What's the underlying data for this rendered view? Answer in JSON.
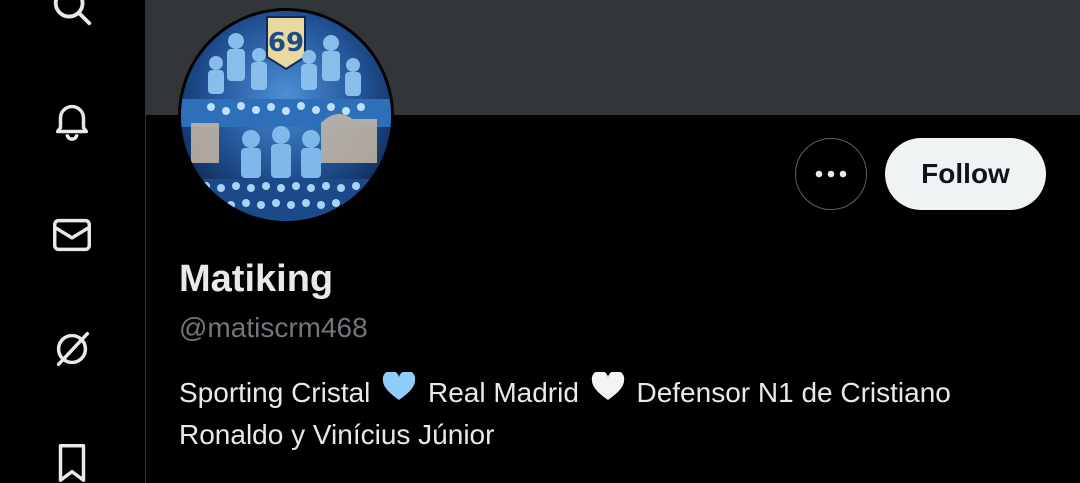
{
  "nav": {
    "items": [
      {
        "icon": "search-icon"
      },
      {
        "icon": "bell-icon"
      },
      {
        "icon": "mail-icon"
      },
      {
        "icon": "grok-icon"
      },
      {
        "icon": "bookmark-icon"
      }
    ]
  },
  "profile": {
    "display_name": "Matiking",
    "handle": "@matiscrm468",
    "bio": {
      "part1": "Sporting Cristal",
      "heart1_color": "#8ecdf8",
      "part2": "Real Madrid",
      "heart2_color": "#f4f4f4",
      "part3": "Defensor N1 de Cristiano Ronaldo y Vinícius Júnior"
    },
    "avatar_badge": "69"
  },
  "actions": {
    "more_label": "More",
    "follow_label": "Follow"
  },
  "colors": {
    "background": "#000000",
    "banner": "#333639",
    "text_primary": "#e7e9ea",
    "text_secondary": "#71767b",
    "follow_bg": "#eff3f4"
  }
}
